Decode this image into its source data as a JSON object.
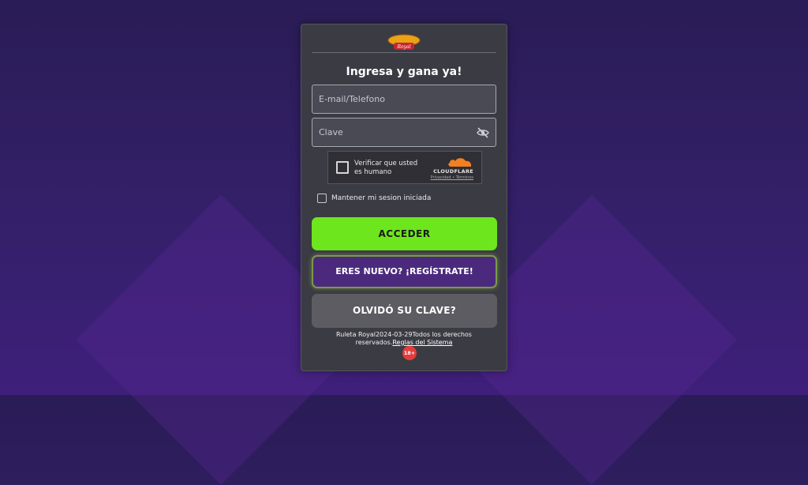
{
  "brand": {
    "logo_text": "Ruleta Royal"
  },
  "form": {
    "title": "Ingresa y gana ya!",
    "email_placeholder": "E-mail/Telefono",
    "password_placeholder": "Clave",
    "remember_label": "Mantener mi sesion iniciada"
  },
  "captcha": {
    "label": "Verificar que usted es humano",
    "provider": "CLOUDFLARE",
    "links": "Privacidad • Términos"
  },
  "buttons": {
    "login": "ACCEDER",
    "register": "ERES NUEVO? ¡REGÍSTRATE!",
    "forgot": "OLVIDÓ SU CLAVE?"
  },
  "footer": {
    "copyright": "Ruleta Royal2024-03-29Todos los derechos reservados.",
    "rules_link": "Reglas del Sistema",
    "age_badge": "18+"
  },
  "colors": {
    "login_button": "#6ee61d",
    "register_button": "#4b2a7d",
    "forgot_button": "#5c5c62",
    "age_badge": "#e53b3b"
  },
  "icons": {
    "password_toggle": "eye-slash-icon",
    "cloudflare": "cloudflare-cloud-icon"
  }
}
